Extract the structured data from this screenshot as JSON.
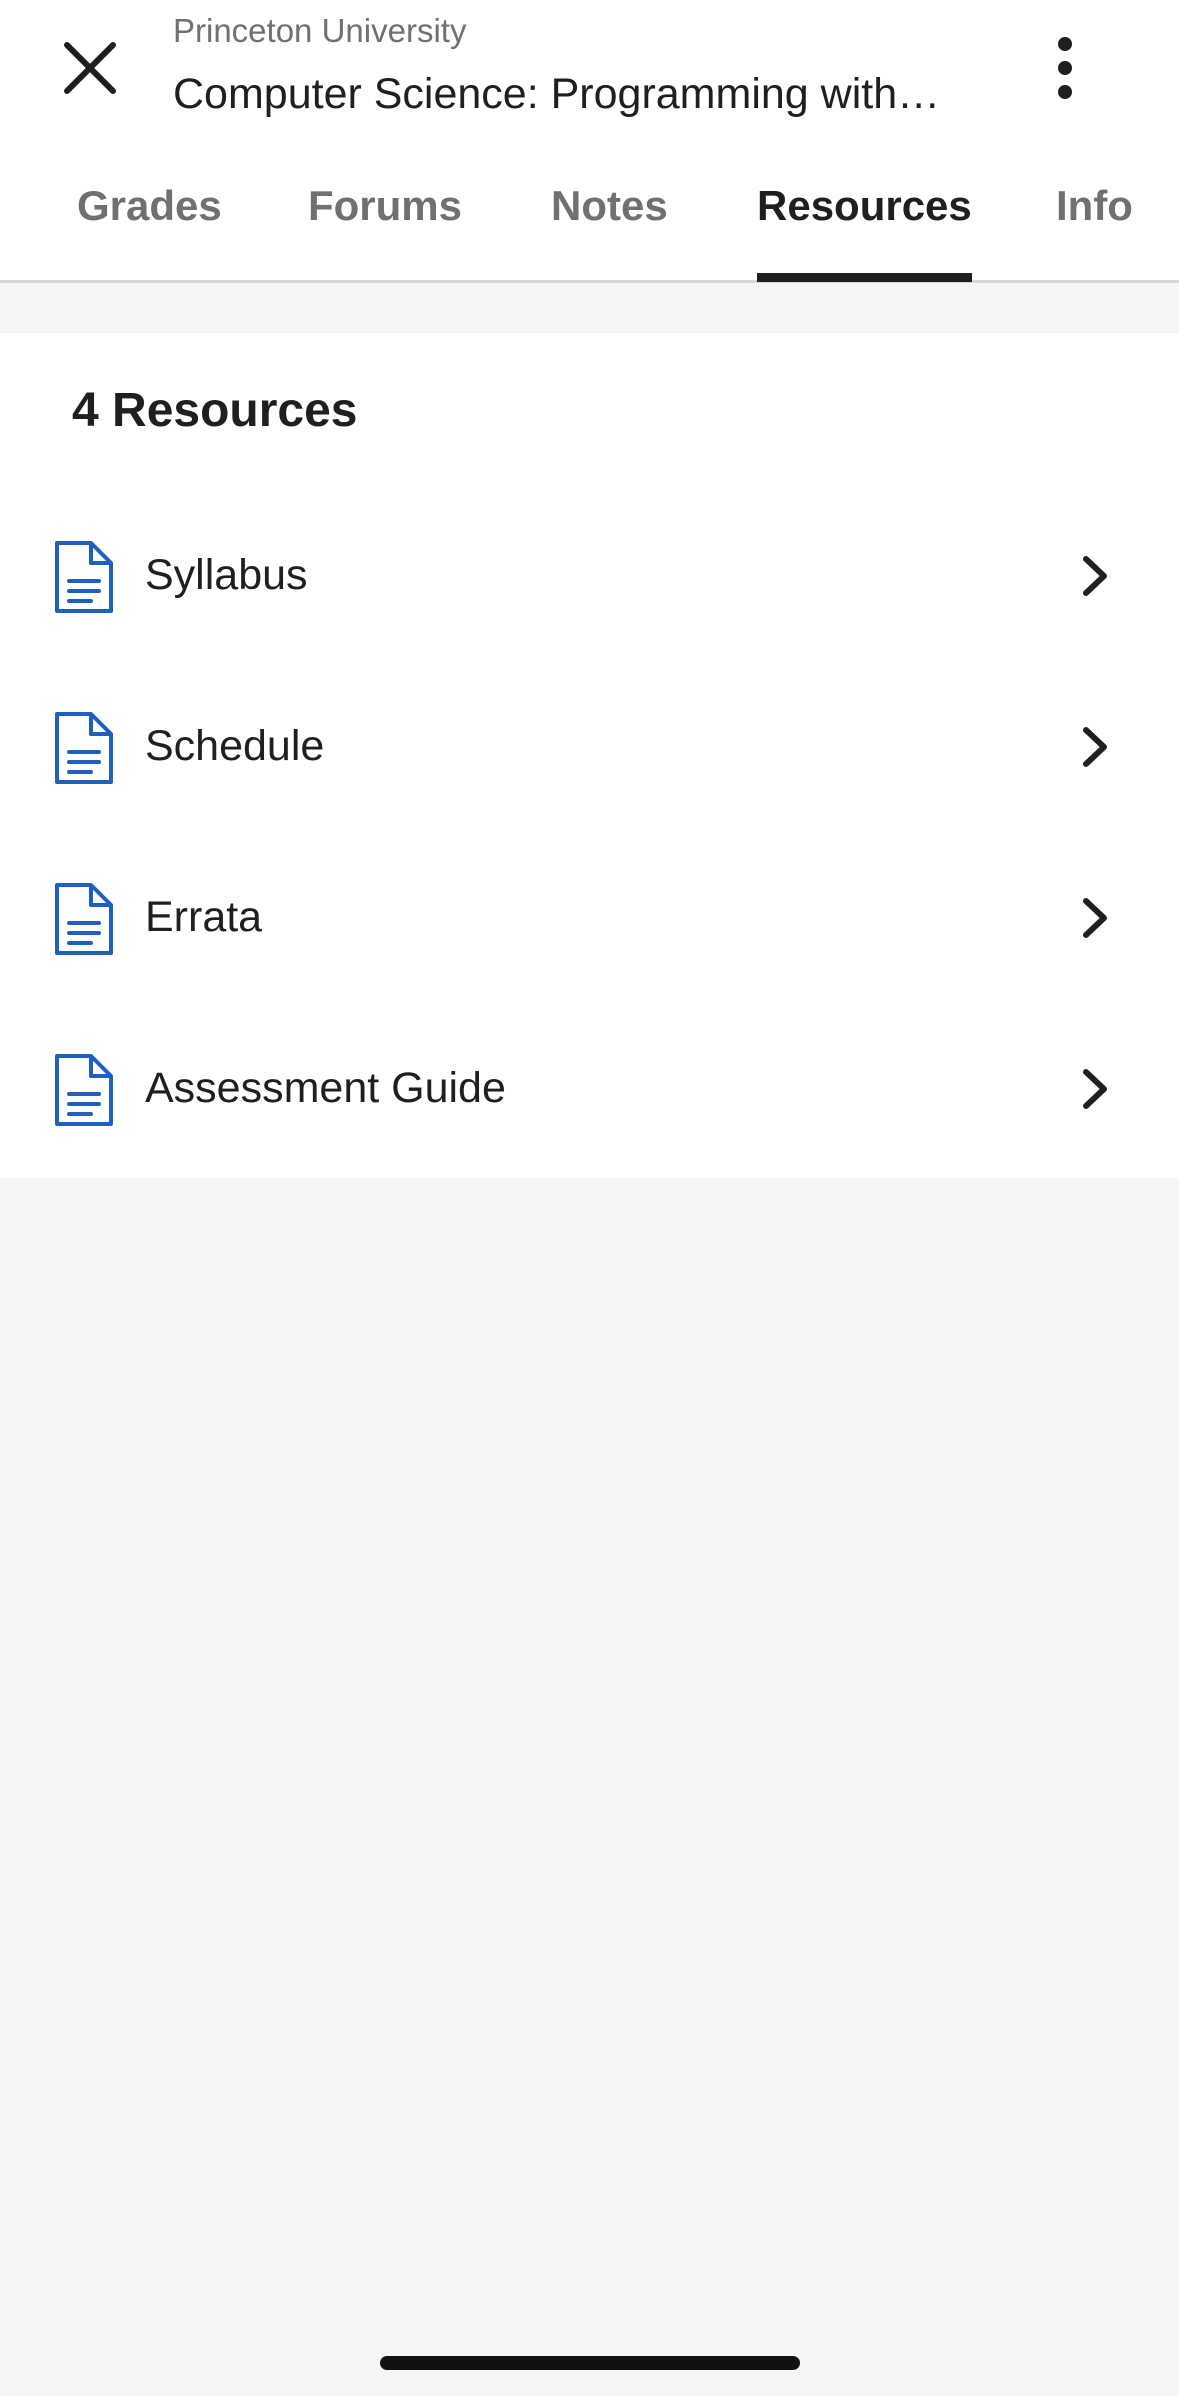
{
  "header": {
    "org_name": "Princeton University",
    "course_title": "Computer Science: Programming with…",
    "close_icon": "close-icon",
    "more_icon": "more-vertical-icon"
  },
  "tabs": [
    {
      "label": "Grades",
      "active": false
    },
    {
      "label": "Forums",
      "active": false
    },
    {
      "label": "Notes",
      "active": false
    },
    {
      "label": "Resources",
      "active": true
    },
    {
      "label": "Info",
      "active": false
    }
  ],
  "resources": {
    "title": "4 Resources",
    "items": [
      {
        "label": "Syllabus",
        "icon": "document-icon"
      },
      {
        "label": "Schedule",
        "icon": "document-icon"
      },
      {
        "label": "Errata",
        "icon": "document-icon"
      },
      {
        "label": "Assessment Guide",
        "icon": "document-icon"
      }
    ]
  },
  "colors": {
    "accent_icon": "#1f5fbf",
    "text_primary": "#1f1f1f",
    "text_secondary": "#707070",
    "background": "#f4f5f7"
  }
}
